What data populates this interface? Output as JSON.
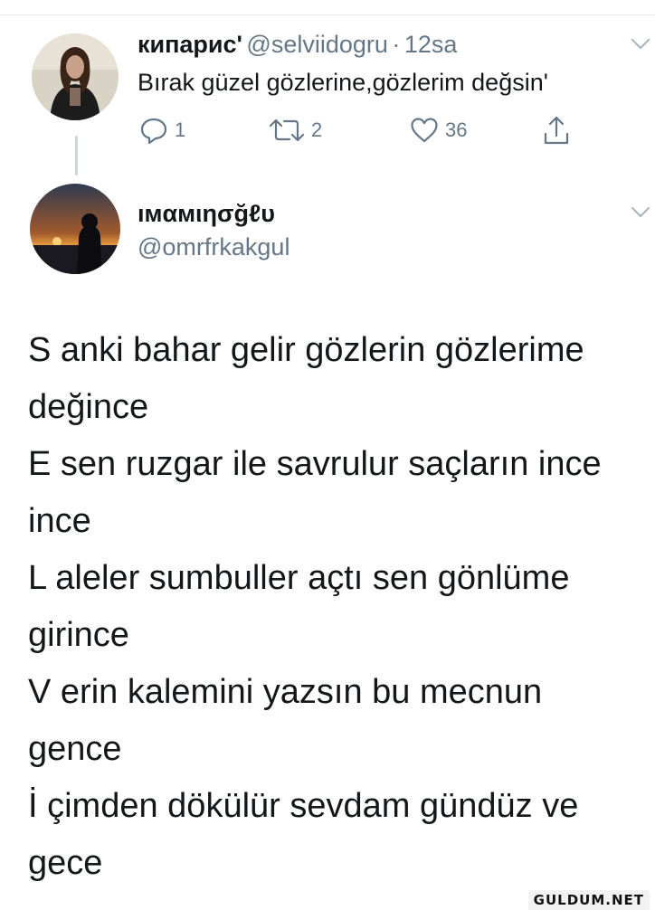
{
  "tweet1": {
    "display_name": "кипарис'",
    "handle": "@selviidogru",
    "separator": "·",
    "time": "12sa",
    "text": "Bırak güzel gözlerine,gözlerim değsin'",
    "actions": {
      "reply_count": "1",
      "retweet_count": "2",
      "like_count": "36"
    },
    "icons": [
      "reply-icon",
      "retweet-icon",
      "like-icon",
      "share-icon",
      "chevron-down-icon"
    ]
  },
  "tweet2": {
    "display_name": "ıмαмιησğℓυ",
    "handle": "@omrfrkakgul",
    "poem_lines": [
      "S anki bahar gelir gözlerin gözlerime",
      "değince",
      "E sen ruzgar ile savrulur saçların ince",
      "ince",
      "L aleler sumbuller açtı sen gönlüme",
      "girince",
      "V erin kalemini yazsın bu mecnun",
      "gence",
      "İ  çimden dökülür sevdam gündüz ve",
      "gece"
    ]
  },
  "watermark": "GULDUM.NET",
  "colors": {
    "text": "#14171a",
    "secondary": "#657786",
    "thread_line": "#ccd6dd",
    "divider": "#e6ecf0"
  }
}
